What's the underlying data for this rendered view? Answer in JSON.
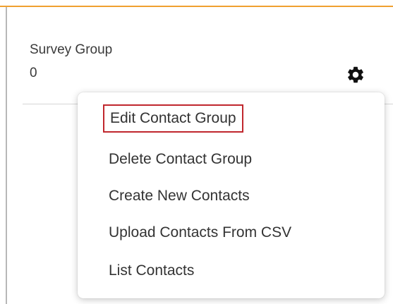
{
  "card": {
    "group_name": "Survey Group",
    "group_count": "0",
    "settings_icon": "gear-icon"
  },
  "menu": {
    "items": [
      {
        "label": "Edit Contact Group",
        "highlighted": true
      },
      {
        "label": "Delete Contact Group"
      },
      {
        "label": "Create New Contacts"
      },
      {
        "label": "Upload Contacts From CSV"
      },
      {
        "label": "List Contacts"
      }
    ]
  },
  "colors": {
    "accent_top": "#f0a030",
    "highlight_border": "#c0272d",
    "text": "#333333"
  }
}
